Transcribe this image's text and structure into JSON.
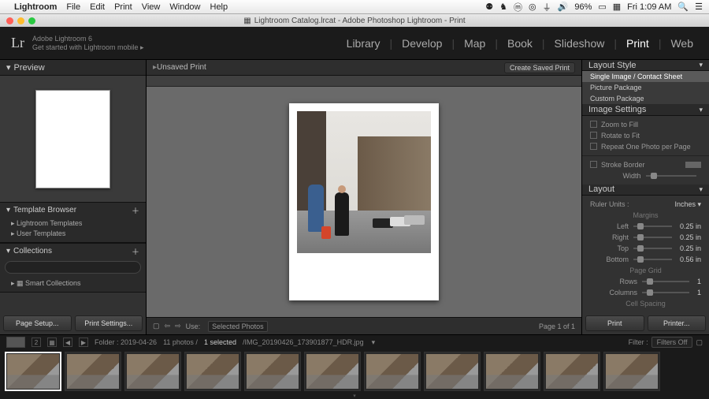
{
  "macmenu": {
    "app": "Lightroom",
    "items": [
      "File",
      "Edit",
      "Print",
      "View",
      "Window",
      "Help"
    ],
    "battery": "96%",
    "clock": "Fri 1:09 AM"
  },
  "window": {
    "title": "Lightroom Catalog.lrcat - Adobe Photoshop Lightroom - Print"
  },
  "topbar": {
    "logo": "Lr",
    "line1": "Adobe Lightroom 6",
    "line2": "Get started with Lightroom mobile  ▸",
    "modules": [
      "Library",
      "Develop",
      "Map",
      "Book",
      "Slideshow",
      "Print",
      "Web"
    ],
    "active": "Print"
  },
  "left": {
    "preview": "Preview",
    "tbrowser": "Template Browser",
    "templates": [
      "Lightroom Templates",
      "User Templates"
    ],
    "collections": "Collections",
    "smart": "Smart Collections",
    "btn1": "Page Setup...",
    "btn2": "Print Settings..."
  },
  "center": {
    "title": "Unsaved Print",
    "save": "Create Saved Print",
    "use": "Use:",
    "useval": "Selected Photos",
    "page": "Page 1 of 1"
  },
  "right": {
    "layoutstyle": "Layout Style",
    "styles": [
      "Single Image / Contact Sheet",
      "Picture Package",
      "Custom Package"
    ],
    "imgset": "Image Settings",
    "zoom": "Zoom to Fill",
    "rotate": "Rotate to Fit",
    "repeat": "Repeat One Photo per Page",
    "stroke": "Stroke Border",
    "width": "Width",
    "layout": "Layout",
    "ruler": "Ruler Units :",
    "rulerval": "Inches",
    "margins": "Margins",
    "mleft": "Left",
    "mleftv": "0.25 in",
    "mright": "Right",
    "mrightv": "0.25 in",
    "mtop": "Top",
    "mtopv": "0.25 in",
    "mbot": "Bottom",
    "mbotv": "0.56 in",
    "pgrid": "Page Grid",
    "rows": "Rows",
    "rowsv": "1",
    "cols": "Columns",
    "colsv": "1",
    "cellsp": "Cell Spacing",
    "btn1": "Print",
    "btn2": "Printer..."
  },
  "filmstrip": {
    "folder": "Folder : 2019-04-26",
    "count": "11 photos /",
    "sel": "1 selected",
    "file": "/IMG_20190426_173901877_HDR.jpg",
    "filter": "Filter :",
    "filterval": "Filters Off"
  }
}
